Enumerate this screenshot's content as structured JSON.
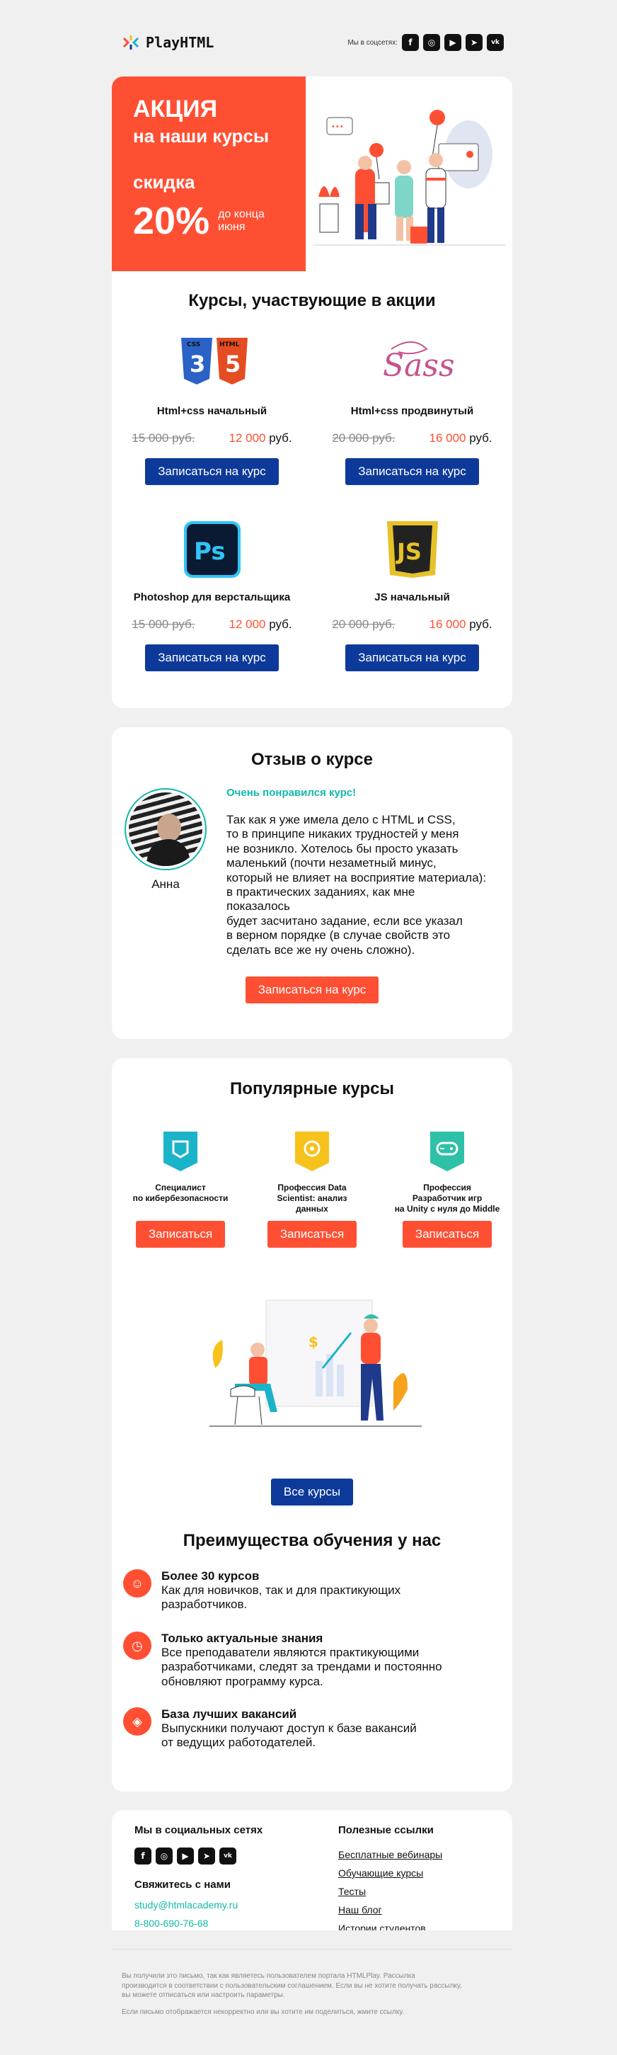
{
  "header": {
    "logo_text": "PlayHTML",
    "social_label": "Мы в соцсетях:",
    "social_icons": [
      "facebook-icon",
      "instagram-icon",
      "youtube-icon",
      "telegram-icon",
      "vk-icon"
    ]
  },
  "promo": {
    "title": "АКЦИЯ",
    "subtitle": "на наши курсы",
    "discount_label": "скидка",
    "discount_value": "20%",
    "until_line1": "до конца",
    "until_line2": "июня"
  },
  "courses": {
    "title": "Курсы, участвующие в акции",
    "items": [
      {
        "name": "Html+css начальный",
        "old_price": "15 000 руб.",
        "new_price": "12 000",
        "currency": "руб.",
        "button": "Записаться на курс"
      },
      {
        "name": "Html+css продвинутый",
        "old_price": "20 000 руб.",
        "new_price": "16 000",
        "currency": "руб.",
        "button": "Записаться на курс"
      },
      {
        "name": "Photoshop для верстальщика",
        "old_price": "15 000 руб.",
        "new_price": "12 000",
        "currency": "руб.",
        "button": "Записаться на курс"
      },
      {
        "name": "JS начальный",
        "old_price": "20 000 руб.",
        "new_price": "16 000",
        "currency": "руб.",
        "button": "Записаться на курс"
      }
    ],
    "logos": {
      "css": "CSS",
      "html": "HTML",
      "sass": "Sass",
      "ps": "Ps",
      "js": "JS"
    }
  },
  "review": {
    "title": "Отзыв о курсе",
    "author": "Анна",
    "headline": "Очень понравился курс!",
    "lines": [
      "Так как я уже имела дело с HTML и CSS,",
      "то в принципе никаких трудностей у меня",
      "не возникло. Хотелось бы просто указать",
      "маленький (почти незаметный минус,",
      "который не влияет на восприятие материала):",
      "в практических заданиях, как мне показалось",
      "будет засчитано задание, если все указал",
      "в верном порядке (в случае свойств это",
      "сделать все же ну очень сложно)."
    ],
    "button": "Записаться на курс"
  },
  "popular": {
    "title": "Популярные курсы",
    "items": [
      {
        "line1": "Специалист",
        "line2": "по кибербезопасности",
        "line3": "",
        "button": "Записаться",
        "color": "#1bb3c9",
        "icon": "shield-icon"
      },
      {
        "line1": "Профессия Data",
        "line2": "Scientist: анализ",
        "line3": "данных",
        "button": "Записаться",
        "color": "#f6c21b",
        "icon": "data-icon"
      },
      {
        "line1": "Профессия",
        "line2": "Разработчик игр",
        "line3": "на Unity с нуля до Middle",
        "button": "Записаться",
        "color": "#2ec1a8",
        "icon": "gamepad-icon"
      }
    ],
    "all_button": "Все курсы"
  },
  "advantages": {
    "title": "Преимущества обучения у нас",
    "items": [
      {
        "title": "Более 30 курсов",
        "lines": [
          "Как для новичков, так и для практикующих",
          "разработчиков."
        ],
        "icon": "smile-icon"
      },
      {
        "title": "Только актуальные знания",
        "lines": [
          "Все преподаватели являются практикующими",
          "разработчиками, следят за трендами и постоянно",
          "обновляют программу курса."
        ],
        "icon": "clock-icon"
      },
      {
        "title": "База лучших вакансий",
        "lines": [
          "Выпускники получают доступ к базе вакансий",
          "от ведущих работодателей."
        ],
        "icon": "target-icon"
      }
    ]
  },
  "footer": {
    "social_title": "Мы в социальных сетях",
    "contact_title": "Свяжитесь с нами",
    "email": "study@htmlacademy.ru",
    "phone": "8-800-690-76-68",
    "links_title": "Полезные ссылки",
    "links": [
      "Бесплатные вебинары",
      "Обучающие курсы",
      "Тесты",
      "Наш блог",
      "Истории студентов"
    ]
  },
  "legal": {
    "line1": "Вы получили это письмо, так как являетесь пользователем портала HTMLPlay. Рассылка",
    "line2": "производится в соответствии с пользовательским соглашением. Если вы не хотите получать рассылку,",
    "line3": "вы можете отписаться или настроить параметры.",
    "line4": "Если письмо отображается некорректно или вы хотите им поделиться, жмите ссылку."
  }
}
